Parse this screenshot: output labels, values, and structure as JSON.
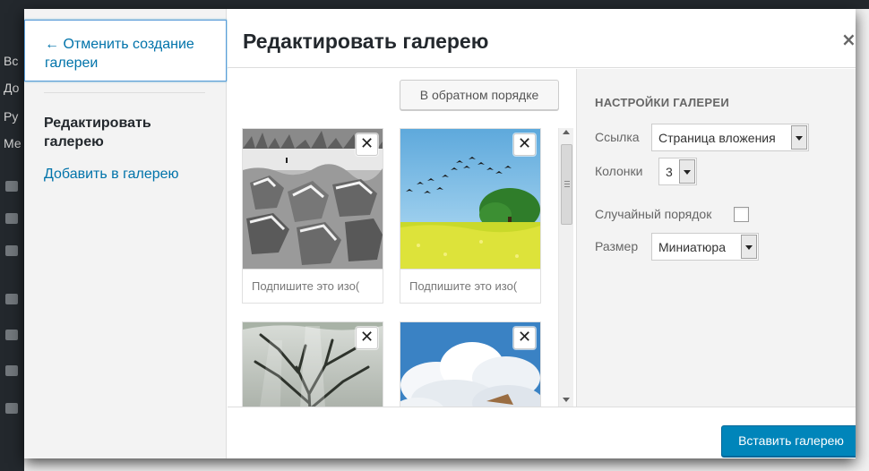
{
  "admin_menu": {
    "items": [
      "Вс",
      "До",
      "Ру",
      "Ме"
    ]
  },
  "menu": {
    "cancel_label": "← Отменить создание галереи",
    "edit_label": "Редактировать галерею",
    "add_label": "Добавить в галерею"
  },
  "header": {
    "title": "Редактировать галерею",
    "close_symbol": "×"
  },
  "toolbar_top": {
    "reverse_label": "В обратном порядке"
  },
  "attachments": [
    {
      "remove_symbol": "✕",
      "caption_placeholder": "Подпишите это изо(",
      "image": "snowy-rocks"
    },
    {
      "remove_symbol": "✕",
      "caption_placeholder": "Подпишите это изо(",
      "image": "birds-over-field"
    },
    {
      "remove_symbol": "✕",
      "caption_placeholder": "",
      "image": "tree-in-fog"
    },
    {
      "remove_symbol": "✕",
      "caption_placeholder": "",
      "image": "clouds-sky"
    }
  ],
  "settings": {
    "title": "НАСТРОЙКИ ГАЛЕРЕИ",
    "link_label": "Ссылка",
    "link_value": "Страница вложения",
    "columns_label": "Колонки",
    "columns_value": "3",
    "random_label": "Случайный порядок",
    "random_checked": false,
    "size_label": "Размер",
    "size_value": "Миниатюра"
  },
  "footer": {
    "insert_label": "Вставить галерею"
  },
  "colors": {
    "primary": "#0085ba",
    "link": "#0073aa",
    "admin_dark": "#23282d"
  }
}
